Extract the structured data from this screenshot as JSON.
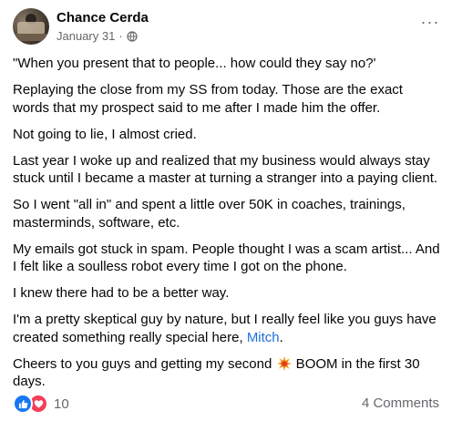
{
  "post": {
    "author": "Chance Cerda",
    "date": "January 31",
    "separator": "·",
    "privacy_icon": "globe-icon",
    "more_label": "···",
    "paragraphs": {
      "p1": "\"When you present that to people... how could they say no?'",
      "p2": "Replaying the close from my SS from today. Those are the exact words that my prospect said to me after I made him the offer.",
      "p3": "Not going to lie, I almost cried.",
      "p4": "Last year I woke up and realized that my business would always stay stuck until I became a master at turning a stranger into a paying client.",
      "p5": "So I went \"all in\" and spent a little over 50K in coaches, trainings, masterminds, software, etc.",
      "p6": "My emails got stuck in spam. People thought I was a scam artist... And I felt like a soulless robot every time I got on the phone.",
      "p7": "I knew there had to be a better way.",
      "p8_before": "I'm a pretty skeptical guy by nature, but I really feel like you guys have created something really special here, ",
      "p8_mention": "Mitch",
      "p8_after": ".",
      "p9_before": "Cheers to you guys and getting my second ",
      "p9_emoji_icon": "collision-icon",
      "p9_after": " BOOM in the first 30 days."
    },
    "reactions": {
      "icons": [
        "like-icon",
        "love-icon"
      ],
      "count": "10"
    },
    "comments_label": "4 Comments"
  },
  "colors": {
    "link": "#216fdb",
    "secondary_text": "#65676b",
    "like": "#1877f2",
    "love": "#f33e58"
  }
}
